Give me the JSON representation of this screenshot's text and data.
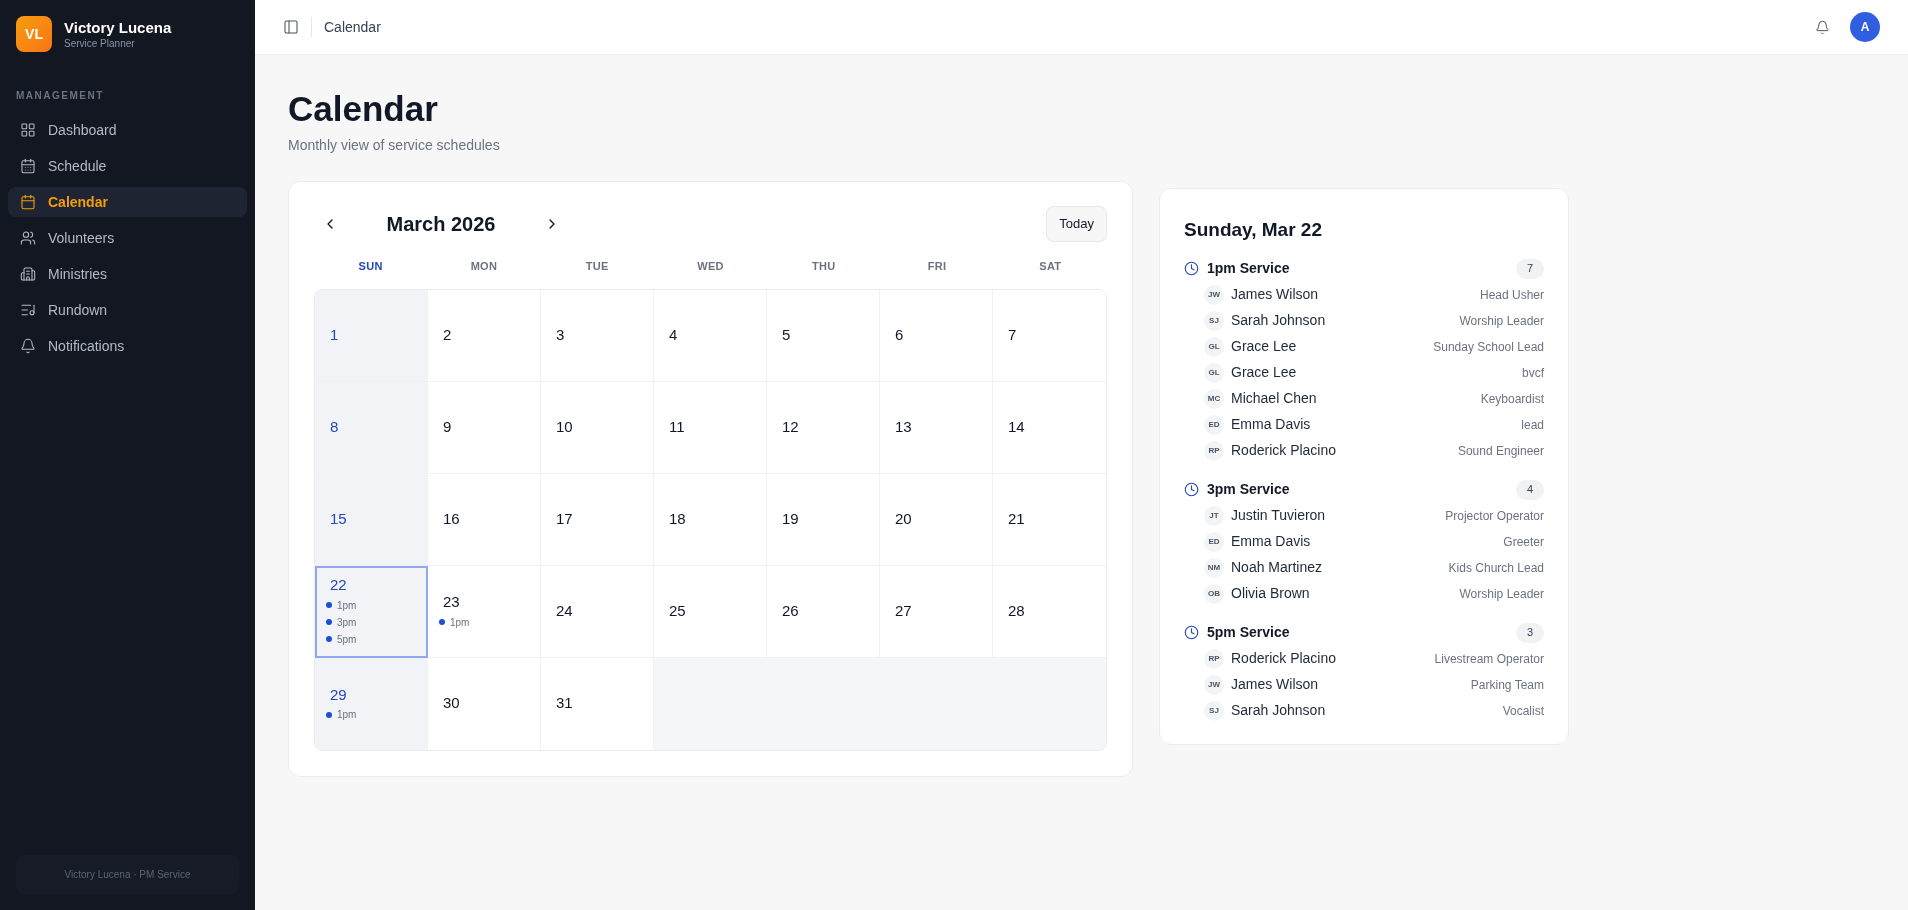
{
  "sidebar": {
    "logo": "VL",
    "title": "Victory Lucena",
    "subtitle": "Service Planner",
    "section": "MANAGEMENT",
    "items": [
      {
        "label": "Dashboard",
        "selected": false
      },
      {
        "label": "Schedule",
        "selected": false
      },
      {
        "label": "Calendar",
        "selected": true
      },
      {
        "label": "Volunteers",
        "selected": false
      },
      {
        "label": "Ministries",
        "selected": false
      },
      {
        "label": "Rundown",
        "selected": false
      },
      {
        "label": "Notifications",
        "selected": false
      }
    ],
    "footer": "Victory Lucena · PM Service"
  },
  "topbar": {
    "breadcrumb": "Calendar",
    "avatar": "A"
  },
  "page": {
    "title": "Calendar",
    "subtitle": "Monthly view of service schedules"
  },
  "calendar": {
    "month": "March 2026",
    "today_button": "Today",
    "weekdays": [
      "SUN",
      "MON",
      "TUE",
      "WED",
      "THU",
      "FRI",
      "SAT"
    ],
    "weeks": [
      [
        {
          "day": "1",
          "selected": false
        },
        {
          "day": "2",
          "selected": false
        },
        {
          "day": "3",
          "selected": false
        },
        {
          "day": "4",
          "selected": false
        },
        {
          "day": "5",
          "selected": false
        },
        {
          "day": "6",
          "selected": false
        },
        {
          "day": "7",
          "selected": false
        }
      ],
      [
        {
          "day": "8",
          "selected": false
        },
        {
          "day": "9",
          "selected": false
        },
        {
          "day": "10",
          "selected": false
        },
        {
          "day": "11",
          "selected": false
        },
        {
          "day": "12",
          "selected": false
        },
        {
          "day": "13",
          "selected": false
        },
        {
          "day": "14",
          "selected": false
        }
      ],
      [
        {
          "day": "15",
          "selected": false
        },
        {
          "day": "16",
          "selected": false
        },
        {
          "day": "17",
          "selected": false
        },
        {
          "day": "18",
          "selected": false
        },
        {
          "day": "19",
          "selected": false
        },
        {
          "day": "20",
          "selected": false
        },
        {
          "day": "21",
          "selected": false
        }
      ],
      [
        {
          "day": "22",
          "selected": true,
          "events": [
            "1pm",
            "3pm",
            "5pm"
          ]
        },
        {
          "day": "23",
          "selected": false,
          "events": [
            "1pm"
          ]
        },
        {
          "day": "24",
          "selected": false
        },
        {
          "day": "25",
          "selected": false
        },
        {
          "day": "26",
          "selected": false
        },
        {
          "day": "27",
          "selected": false
        },
        {
          "day": "28",
          "selected": false
        }
      ],
      [
        {
          "day": "29",
          "selected": false,
          "events": [
            "1pm"
          ]
        },
        {
          "day": "30",
          "selected": false
        },
        {
          "day": "31",
          "selected": false
        },
        {
          "kind": "empty"
        },
        {
          "kind": "empty"
        },
        {
          "kind": "empty"
        },
        {
          "kind": "empty"
        }
      ]
    ]
  },
  "detail": {
    "title": "Sunday, Mar 22",
    "services": [
      {
        "name": "1pm Service",
        "count": "7",
        "people": [
          {
            "initials": "JW",
            "name": "James Wilson",
            "role": "Head Usher"
          },
          {
            "initials": "SJ",
            "name": "Sarah Johnson",
            "role": "Worship Leader"
          },
          {
            "initials": "GL",
            "name": "Grace Lee",
            "role": "Sunday School Lead"
          },
          {
            "initials": "GL",
            "name": "Grace Lee",
            "role": "bvcf"
          },
          {
            "initials": "MC",
            "name": "Michael Chen",
            "role": "Keyboardist"
          },
          {
            "initials": "ED",
            "name": "Emma Davis",
            "role": "lead"
          },
          {
            "initials": "RP",
            "name": "Roderick Placino",
            "role": "Sound Engineer"
          }
        ]
      },
      {
        "name": "3pm Service",
        "count": "4",
        "people": [
          {
            "initials": "JT",
            "name": "Justin Tuvieron",
            "role": "Projector Operator"
          },
          {
            "initials": "ED",
            "name": "Emma Davis",
            "role": "Greeter"
          },
          {
            "initials": "NM",
            "name": "Noah Martinez",
            "role": "Kids Church Lead"
          },
          {
            "initials": "OB",
            "name": "Olivia Brown",
            "role": "Worship Leader"
          }
        ]
      },
      {
        "name": "5pm Service",
        "count": "3",
        "people": [
          {
            "initials": "RP",
            "name": "Roderick Placino",
            "role": "Livestream Operator"
          },
          {
            "initials": "JW",
            "name": "James Wilson",
            "role": "Parking Team"
          },
          {
            "initials": "SJ",
            "name": "Sarah Johnson",
            "role": "Vocalist"
          }
        ]
      }
    ]
  }
}
